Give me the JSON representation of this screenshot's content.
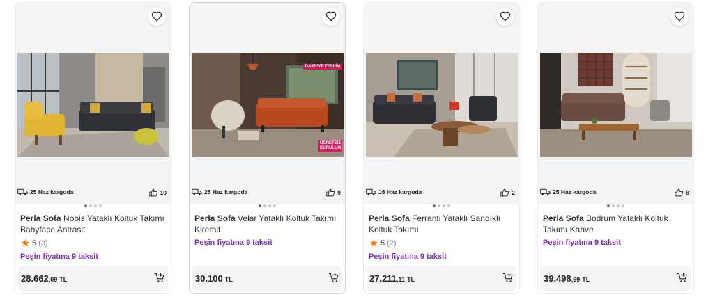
{
  "products": [
    {
      "brand": "Perla Sofa",
      "name": "Nobis Yataklı Koltuk Takımı Babyface Antrasit",
      "shipping": "25 Haz kargoda",
      "likes": "10",
      "rating": "5",
      "rating_count": "(3)",
      "installment": "Peşin fiyatına 9 taksit",
      "price_int": "28.662",
      "price_dec": ",09",
      "currency": "TL"
    },
    {
      "brand": "Perla Sofa",
      "name": "Velar Yataklı Koltuk Takımı Kiremit",
      "shipping": "25 Haz kargoda",
      "likes": "9",
      "installment": "Peşin fiyatına 9 taksit",
      "price_int": "30.100",
      "price_dec": "",
      "currency": "TL",
      "badges": [
        "DAİREYE TESLİM",
        "ÜCRETSİZ KURULUM"
      ]
    },
    {
      "brand": "Perla Sofa",
      "name": "Ferranti Yataklı Sandıklı Koltuk Takımı",
      "shipping": "16 Haz kargoda",
      "likes": "2",
      "rating": "5",
      "rating_count": "(2)",
      "installment": "Peşin fiyatına 9 taksit",
      "price_int": "27.211",
      "price_dec": ",11",
      "currency": "TL"
    },
    {
      "brand": "Perla Sofa",
      "name": "Bodrum Yataklı Koltuk Takımı Kahve",
      "shipping": "25 Haz kargoda",
      "likes": "8",
      "installment": "Peşin fiyatına 9 taksit",
      "price_int": "39.498",
      "price_dec": ",69",
      "currency": "TL"
    }
  ],
  "colors": {
    "installment": "#7b2cbf",
    "star": "#f27a1a",
    "badge": "#d81b60",
    "card_border": "#ececec"
  },
  "icons": {
    "favorite": "heart-outline-icon",
    "shipping": "truck-icon",
    "likes": "thumbs-up-icon",
    "rating": "star-icon",
    "cart": "add-to-cart-icon"
  }
}
